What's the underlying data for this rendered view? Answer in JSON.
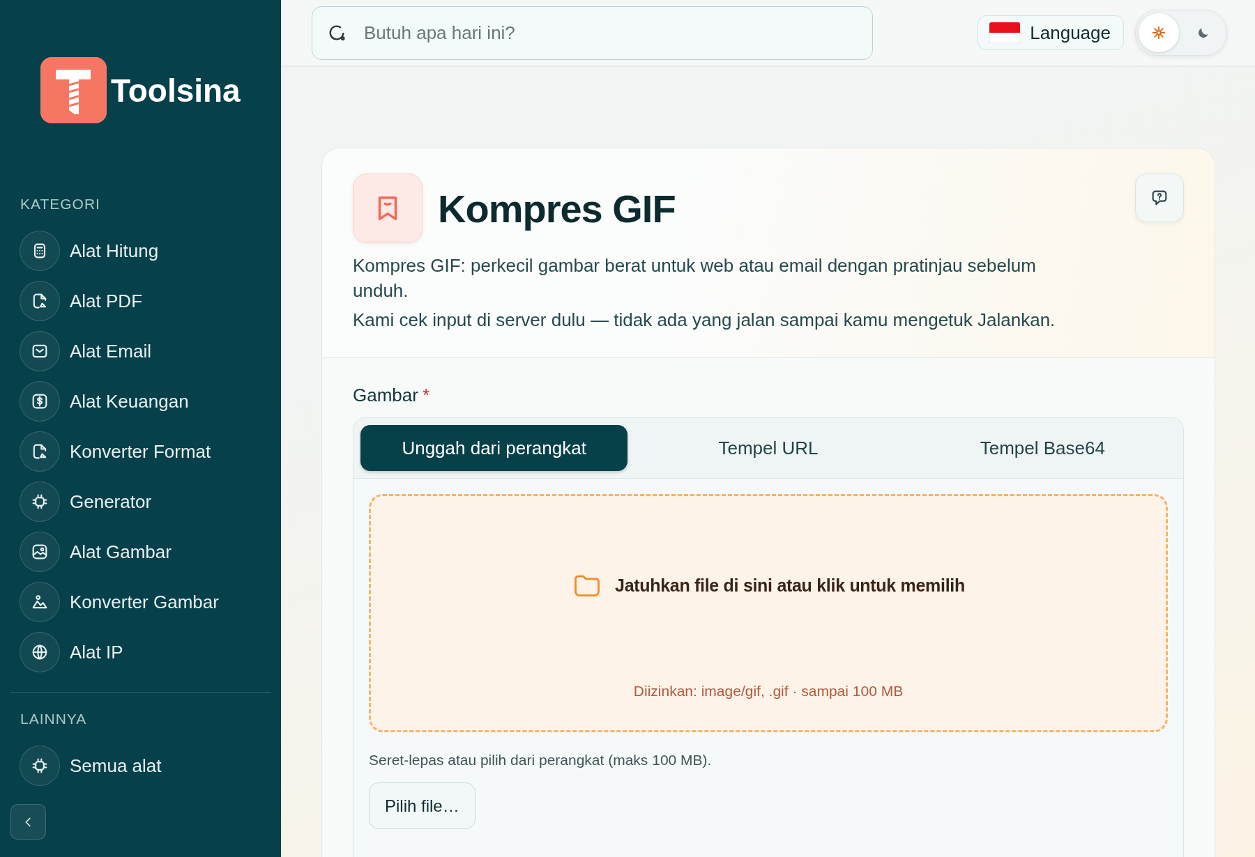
{
  "brand": {
    "name": "Toolsina"
  },
  "sidebar": {
    "sections": [
      {
        "heading": "KATEGORI",
        "items": [
          {
            "label": "Alat Hitung"
          },
          {
            "label": "Alat PDF"
          },
          {
            "label": "Alat Email"
          },
          {
            "label": "Alat Keuangan"
          },
          {
            "label": "Konverter Format"
          },
          {
            "label": "Generator"
          },
          {
            "label": "Alat Gambar"
          },
          {
            "label": "Konverter Gambar"
          },
          {
            "label": "Alat IP"
          }
        ]
      },
      {
        "heading": "LAINNYA",
        "items": [
          {
            "label": "Semua alat"
          }
        ]
      }
    ]
  },
  "search": {
    "placeholder": "Butuh apa hari ini?"
  },
  "language_button": {
    "label": "Language"
  },
  "theme_toggle": {
    "options": [
      {
        "kind": "light",
        "selected": true
      },
      {
        "kind": "dark",
        "selected": false
      }
    ]
  },
  "tool": {
    "title": "Kompres GIF",
    "description": [
      "Kompres GIF: perkecil gambar berat untuk web atau email dengan pratinjau sebelum unduh.",
      "Kami cek input di server dulu — tidak ada yang jalan sampai kamu mengetuk Jalankan."
    ]
  },
  "form": {
    "field_label": "Gambar",
    "required_mark": "*",
    "tabs": [
      {
        "label": "Unggah dari perangkat",
        "selected": true
      },
      {
        "label": "Tempel URL",
        "selected": false
      },
      {
        "label": "Tempel Base64",
        "selected": false
      }
    ],
    "dropzone": {
      "prompt": "Jatuhkan file di sini atau klik untuk memilih",
      "allowed": "Diizinkan: image/gif, .gif · sampai 100 MB"
    },
    "hint": "Seret-lepas atau pilih dari perangkat (maks 100 MB).",
    "button": "Pilih file…"
  }
}
